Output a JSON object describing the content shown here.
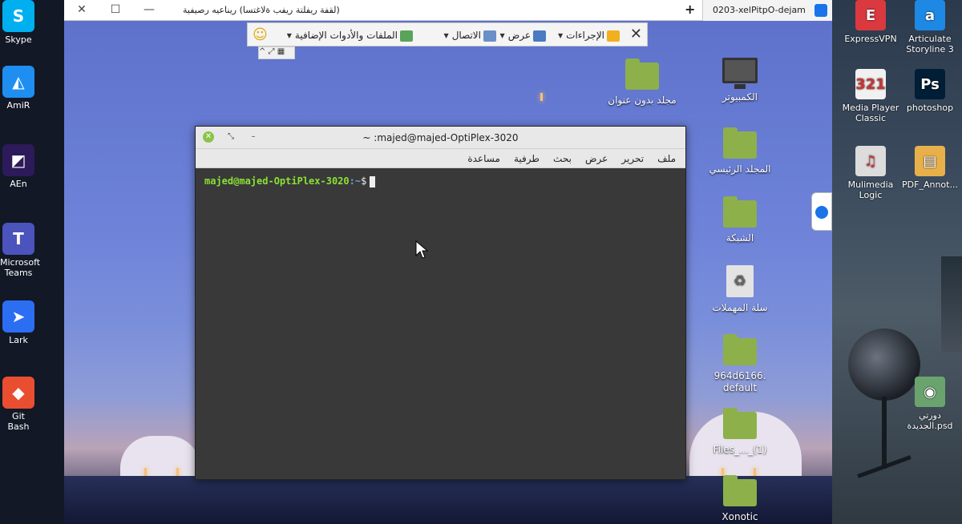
{
  "host_left_icons": [
    {
      "label": "Skype",
      "color": "#00aff0",
      "glyph": "S"
    },
    {
      "label": "AmiR",
      "color": "#1f8ef1",
      "glyph": "◭"
    },
    {
      "label": "AEn",
      "color": "#2c1a5a",
      "glyph": "◩"
    },
    {
      "label": "Microsoft Teams",
      "color": "#4b53bc",
      "glyph": "T"
    },
    {
      "label": "Lark",
      "color": "#2c6ef2",
      "glyph": "➤"
    },
    {
      "label": "Git Bash",
      "color": "#e94e31",
      "glyph": "◆"
    }
  ],
  "host_right_icons": [
    {
      "label": "ExpressVPN",
      "color": "#da3940",
      "glyph": "E"
    },
    {
      "label": "Articulate Storyline 3",
      "color": "#1e88e5",
      "glyph": "a"
    },
    {
      "label": "Media Player Classic",
      "color": "#f1f1f1",
      "glyph": "321"
    },
    {
      "label": "photoshop",
      "color": "#001e36",
      "glyph": "Ps"
    },
    {
      "label": "Mulimedia Logic",
      "color": "#dcdcdc",
      "glyph": "♫"
    },
    {
      "label": "PDF_Annot...",
      "color": "#e8b04a",
      "glyph": "▤"
    },
    {
      "label": "دورتي الجديدة.psd",
      "color": "#6aa36e",
      "glyph": "◉"
    }
  ],
  "remote_window": {
    "title": "(لقفة ريفلتة ريفب ةلاغتسا) ريناعيه رصيفية",
    "tab_label": "majed-OptiPlex-3020",
    "new_tab": "+",
    "min": "—",
    "max": "☐",
    "close": "✕"
  },
  "tv_toolbar": {
    "close": "✕",
    "actions": "الإجراءات",
    "view": "عرض",
    "communicate": "الاتصال",
    "files": "الملفات والأدوات الإضافية",
    "smiley": "☺",
    "mini": "^ ⤢ ▦"
  },
  "desktop_icons": [
    {
      "label": "الكمبيوتر",
      "type": "monitor"
    },
    {
      "label": "مجلد بدون عنوان",
      "type": "folder"
    },
    {
      "label": "المجلد الرئيسي",
      "type": "folder"
    },
    {
      "label": "الشبكة",
      "type": "folder"
    },
    {
      "label": "سلة المهملات",
      "type": "trash"
    },
    {
      "label": "964d6166. default",
      "type": "folder"
    },
    {
      "label": "Files_..._(1)",
      "type": "folder"
    },
    {
      "label": "Xonotic",
      "type": "folder"
    }
  ],
  "terminal": {
    "title": "~ :majed@majed-OptiPlex-3020",
    "menu": [
      "ملف",
      "تحرير",
      "عرض",
      "بحث",
      "طرفية",
      "مساعدة"
    ],
    "prompt_user": "majed@majed-OptiPlex-3020",
    "prompt_path": ":~",
    "prompt_symbol": "$"
  }
}
